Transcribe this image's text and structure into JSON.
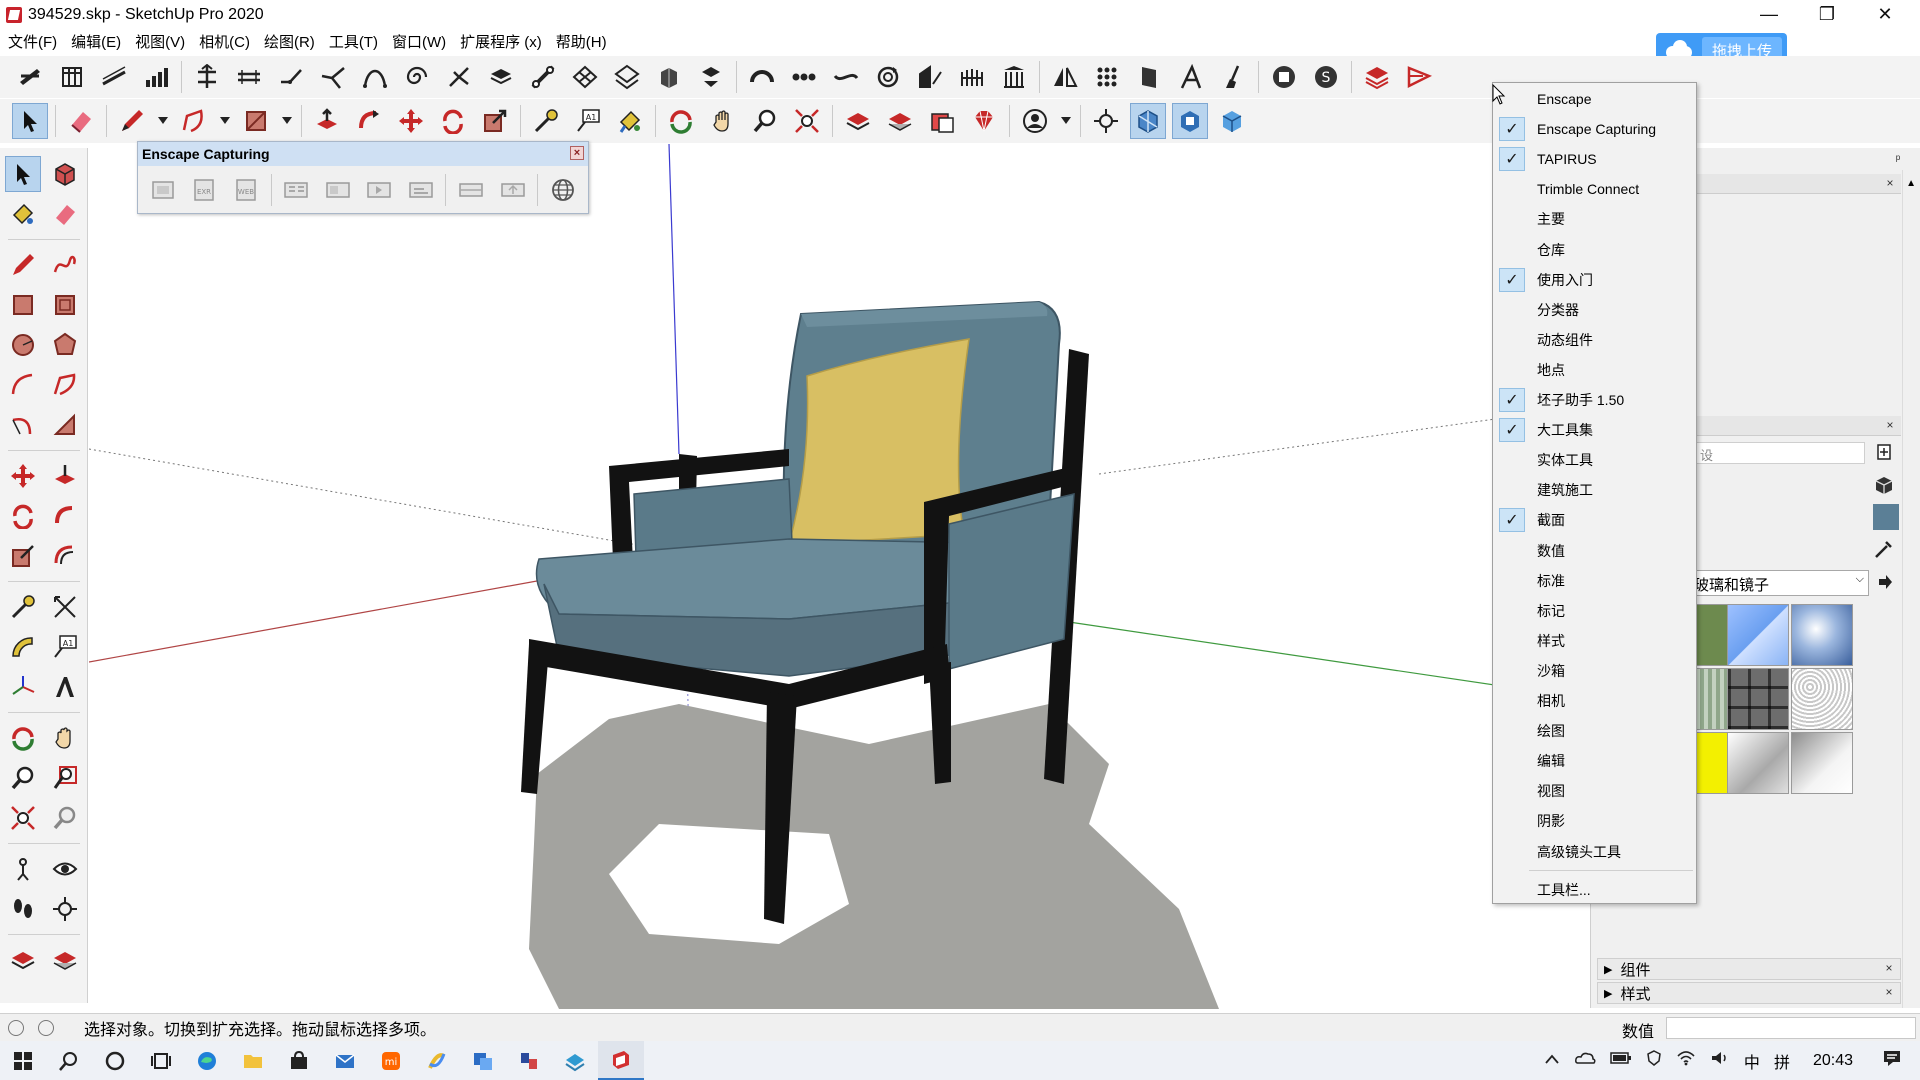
{
  "window": {
    "title": "394529.skp - SketchUp Pro 2020",
    "minimize_glyph": "—",
    "restore_glyph": "❐",
    "close_glyph": "✕"
  },
  "menu": {
    "items": [
      "文件(F)",
      "编辑(E)",
      "视图(V)",
      "相机(C)",
      "绘图(R)",
      "工具(T)",
      "窗口(W)",
      "扩展程序 (x)",
      "帮助(H)"
    ]
  },
  "upload_button": {
    "label": "拖拽上传"
  },
  "enscape_window": {
    "title": "Enscape Capturing",
    "close": "×"
  },
  "context_menu": {
    "items": [
      {
        "label": "Enscape",
        "checked": false
      },
      {
        "label": "Enscape Capturing",
        "checked": true
      },
      {
        "label": "TAPIRUS",
        "checked": true
      },
      {
        "label": "Trimble Connect",
        "checked": false
      },
      {
        "label": "主要",
        "checked": false
      },
      {
        "label": "仓库",
        "checked": false
      },
      {
        "label": "使用入门",
        "checked": true
      },
      {
        "label": "分类器",
        "checked": false
      },
      {
        "label": "动态组件",
        "checked": false
      },
      {
        "label": "地点",
        "checked": false
      },
      {
        "label": "坯子助手 1.50",
        "checked": true
      },
      {
        "label": "大工具集",
        "checked": true
      },
      {
        "label": "实体工具",
        "checked": false
      },
      {
        "label": "建筑施工",
        "checked": false
      },
      {
        "label": "截面",
        "checked": true
      },
      {
        "label": "数值",
        "checked": false
      },
      {
        "label": "标准",
        "checked": false
      },
      {
        "label": "标记",
        "checked": false
      },
      {
        "label": "样式",
        "checked": false
      },
      {
        "label": "沙箱",
        "checked": false
      },
      {
        "label": "相机",
        "checked": false
      },
      {
        "label": "绘图",
        "checked": false
      },
      {
        "label": "编辑",
        "checked": false
      },
      {
        "label": "视图",
        "checked": false
      },
      {
        "label": "阴影",
        "checked": false
      },
      {
        "label": "高级镜头工具",
        "checked": false
      }
    ],
    "footer": "工具栏...",
    "check_glyph": "✓"
  },
  "tray": {
    "pin": "ᵖ",
    "close": "×",
    "search_partial": "设",
    "material_select": "玻璃和镜子",
    "sections": [
      {
        "label": "组件"
      },
      {
        "label": "样式"
      }
    ]
  },
  "status": {
    "hint": "选择对象。切换到扩充选择。拖动鼠标选择多项。",
    "value_label": "数值"
  },
  "taskbar": {
    "ime": "中",
    "layout": "拼",
    "time": "20:43"
  },
  "colors": {
    "selection_blue": "#b8d4ee",
    "upload_blue": "#3f9bf6",
    "seat_blue": "#5e7f8e",
    "pillow_yellow": "#d8bf63",
    "frame_black": "#121212",
    "shadow_gray": "#a3a39f",
    "axis_red": "#b04545",
    "axis_green": "#3f9a3f",
    "axis_blue": "#3a3ad0"
  }
}
